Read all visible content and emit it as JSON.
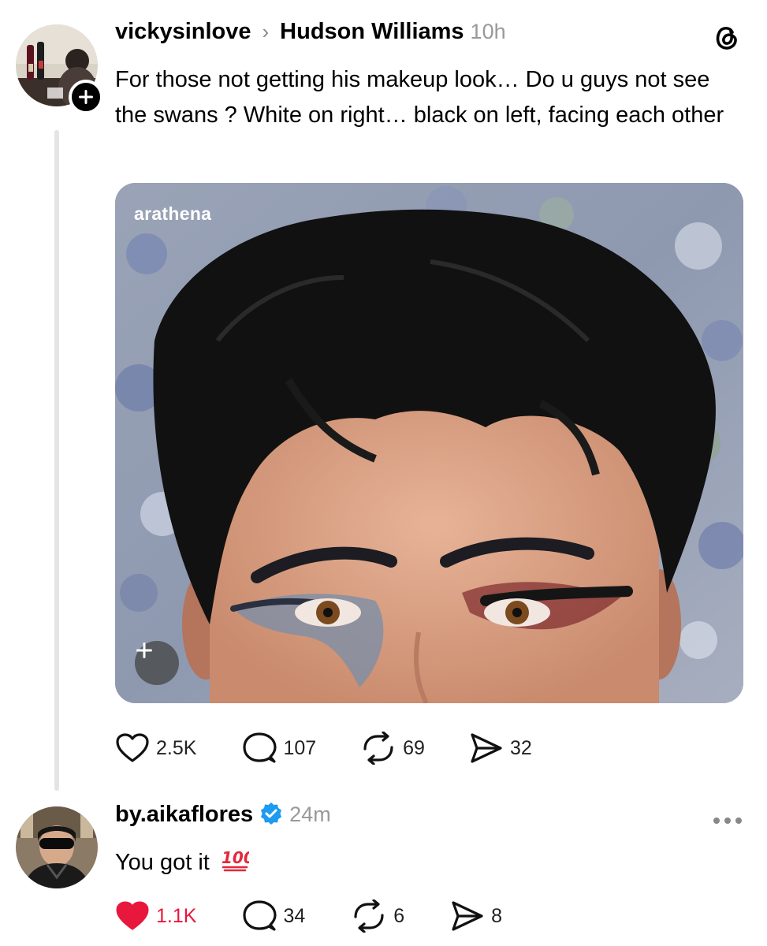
{
  "post": {
    "author": "vickysinlove",
    "chevron": "›",
    "reply_to": "Hudson Williams",
    "time": "10h",
    "text": "For those not getting his makeup look… Do u guys not see the swans ? White on right… black on left, facing each other",
    "media_watermark": "arathena",
    "stats": {
      "likes": "2.5K",
      "comments": "107",
      "reposts": "69",
      "shares": "32"
    },
    "app_icon": "threads-logo-icon"
  },
  "reply": {
    "author": "by.aikaflores",
    "verified": true,
    "time": "24m",
    "text": "You got it",
    "emoji": "💯",
    "stats": {
      "likes": "1.1K",
      "comments": "34",
      "reposts": "6",
      "shares": "8"
    },
    "liked": true
  },
  "colors": {
    "like_active": "#e8173c",
    "verified": "#1d9bf0",
    "muted": "#999999"
  }
}
